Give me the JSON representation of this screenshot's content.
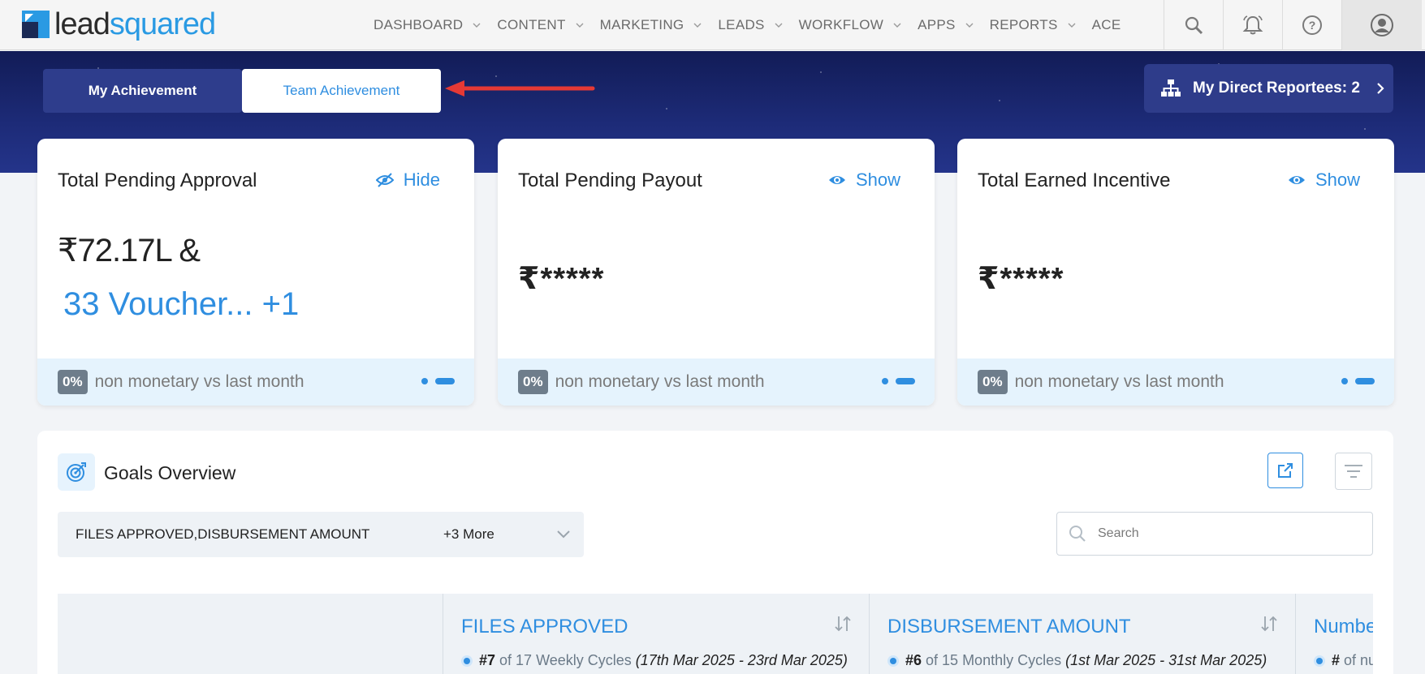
{
  "nav": {
    "logo_lead": "lead",
    "logo_squared": "squared",
    "menu": [
      {
        "label": "DASHBOARD"
      },
      {
        "label": "CONTENT"
      },
      {
        "label": "MARKETING"
      },
      {
        "label": "LEADS"
      },
      {
        "label": "WORKFLOW"
      },
      {
        "label": "APPS"
      },
      {
        "label": "REPORTS"
      },
      {
        "label": "ACE"
      }
    ],
    "icons": [
      "search-icon",
      "bell-icon",
      "help-icon",
      "profile-icon"
    ]
  },
  "banner": {
    "tabs": [
      {
        "label": "My Achievement",
        "active": false
      },
      {
        "label": "Team Achievement",
        "active": true
      }
    ],
    "reportees_label": "My Direct Reportees: 2"
  },
  "cards": [
    {
      "title": "Total Pending Approval",
      "toggle": "Hide",
      "amount": "₹72.17L &",
      "vouchers": "33 Voucher... +1",
      "pct": "0%",
      "foot": "non monetary vs last month"
    },
    {
      "title": "Total Pending Payout",
      "toggle": "Show",
      "masked": "₹*****",
      "pct": "0%",
      "foot": "non monetary vs last month"
    },
    {
      "title": "Total Earned Incentive",
      "toggle": "Show",
      "masked": "₹*****",
      "pct": "0%",
      "foot": "non monetary vs last month"
    }
  ],
  "goals": {
    "title": "Goals Overview",
    "selected_metrics": "FILES APPROVED,DISBURSEMENT AMOUNT",
    "more": "+3 More",
    "search_placeholder": "Search",
    "columns": [
      {
        "title": "FILES APPROVED",
        "cycle_num": "#7",
        "cycle_of": "of 17 Weekly Cycles",
        "range": "(17th Mar 2025 - 23rd Mar 2025)"
      },
      {
        "title": "DISBURSEMENT AMOUNT",
        "cycle_num": "#6",
        "cycle_of": "of 15 Monthly Cycles",
        "range": "(1st Mar 2025 - 31st Mar 2025)"
      },
      {
        "title": "Numbe",
        "cycle_num": "#",
        "cycle_of": "of nu",
        "range": ""
      }
    ]
  },
  "colors": {
    "accent": "#2f8ee0",
    "banner": "#1d2b78",
    "arrow": "#e53935"
  }
}
